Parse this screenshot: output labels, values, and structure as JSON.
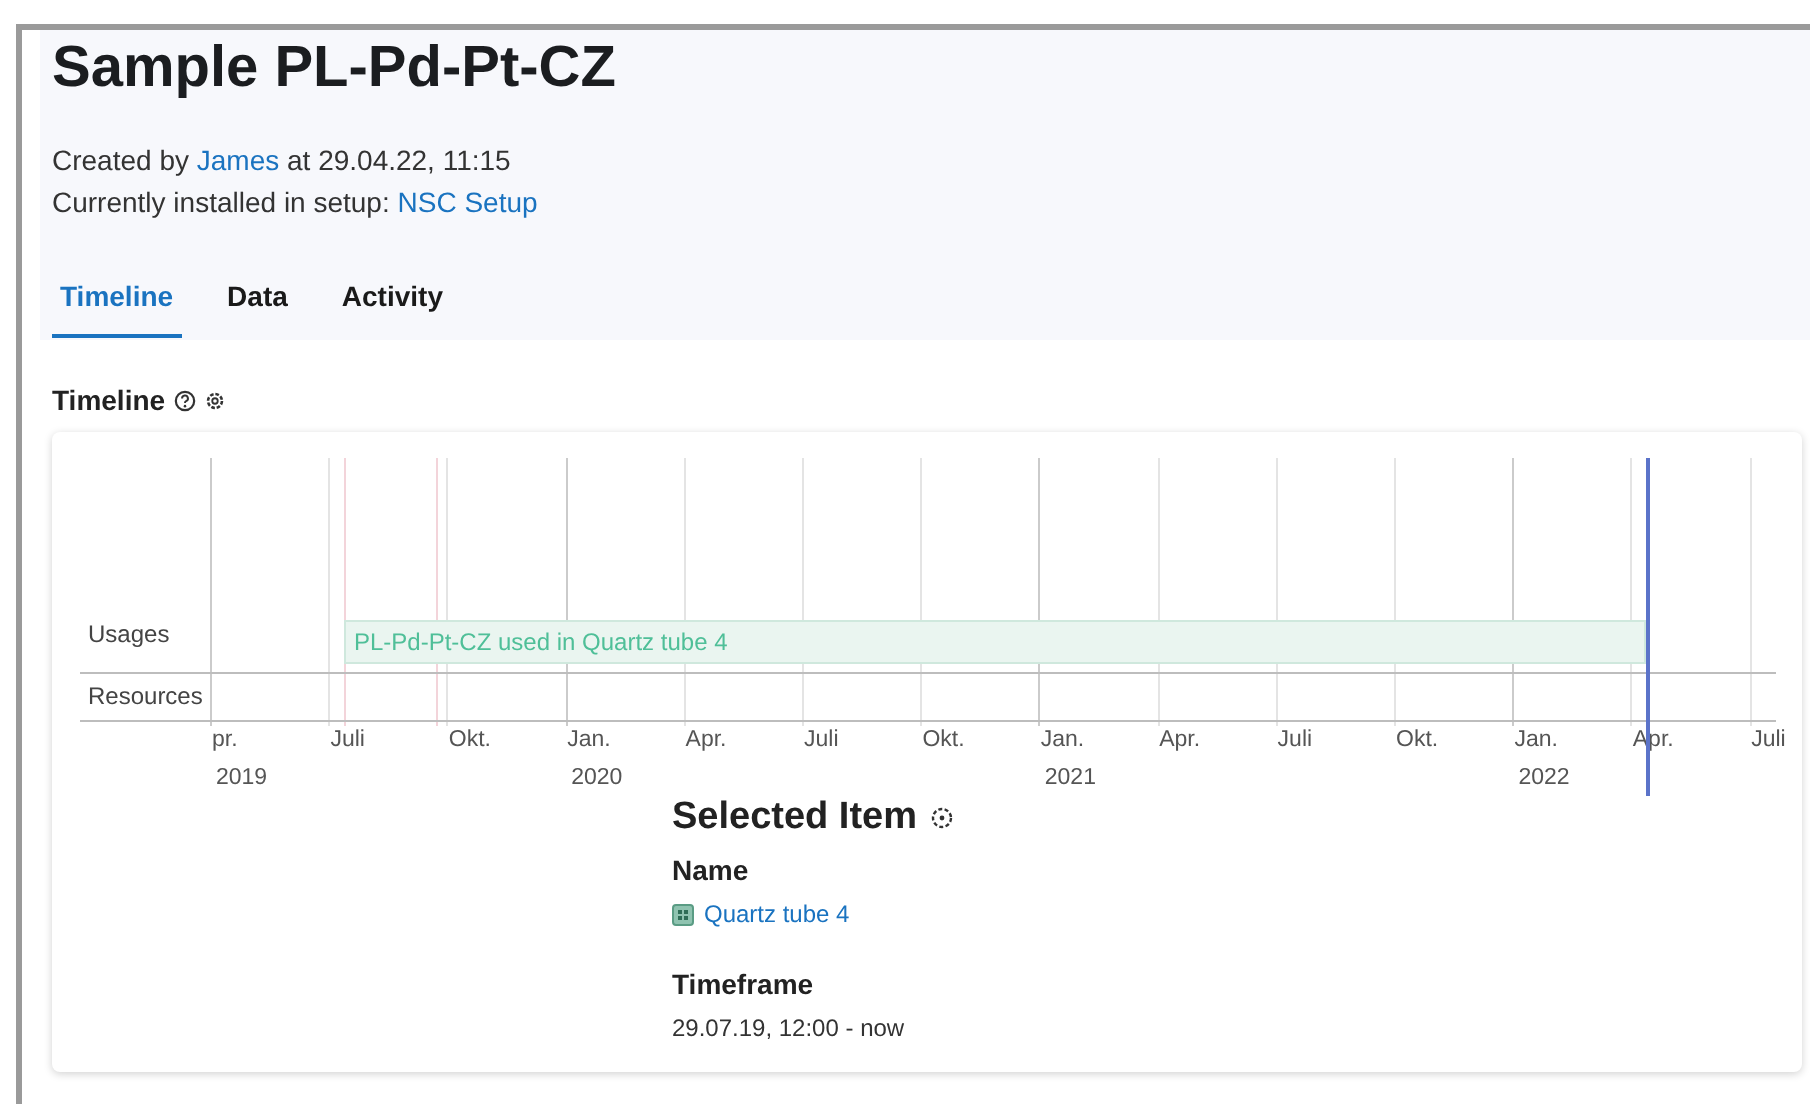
{
  "title": "Sample PL-Pd-Pt-CZ",
  "meta": [
    {
      "prefix": "Created by ",
      "link": "James",
      "suffix": " at 29.04.22, 11:15"
    },
    {
      "prefix": "Currently installed in setup: ",
      "link": "NSC Setup"
    }
  ],
  "tabs": [
    {
      "label": "Timeline",
      "selected": true
    },
    {
      "label": "Data",
      "selected": false
    },
    {
      "label": "Activity",
      "selected": false
    }
  ],
  "section_title": "Timeline",
  "timeline": {
    "rows": [
      "Usages",
      "Resources"
    ],
    "ticks": [
      {
        "label": "pr.",
        "year": "2019"
      },
      {
        "label": "Juli"
      },
      {
        "label": "Okt."
      },
      {
        "label": "Jan.",
        "year": "2020"
      },
      {
        "label": "Apr."
      },
      {
        "label": "Juli"
      },
      {
        "label": "Okt."
      },
      {
        "label": "Jan.",
        "year": "2021"
      },
      {
        "label": "Apr."
      },
      {
        "label": "Juli"
      },
      {
        "label": "Okt."
      },
      {
        "label": "Jan.",
        "year": "2022"
      },
      {
        "label": "Apr."
      },
      {
        "label": "Juli"
      }
    ],
    "bar": {
      "label": "PL-Pd-Pt-CZ used in Quartz tube 4"
    }
  },
  "selected_item": {
    "title": "Selected Item",
    "name_label": "Name",
    "name": "Quartz tube 4",
    "timeframe_label": "Timeframe",
    "timeframe": "29.07.19, 12:00 - now"
  }
}
